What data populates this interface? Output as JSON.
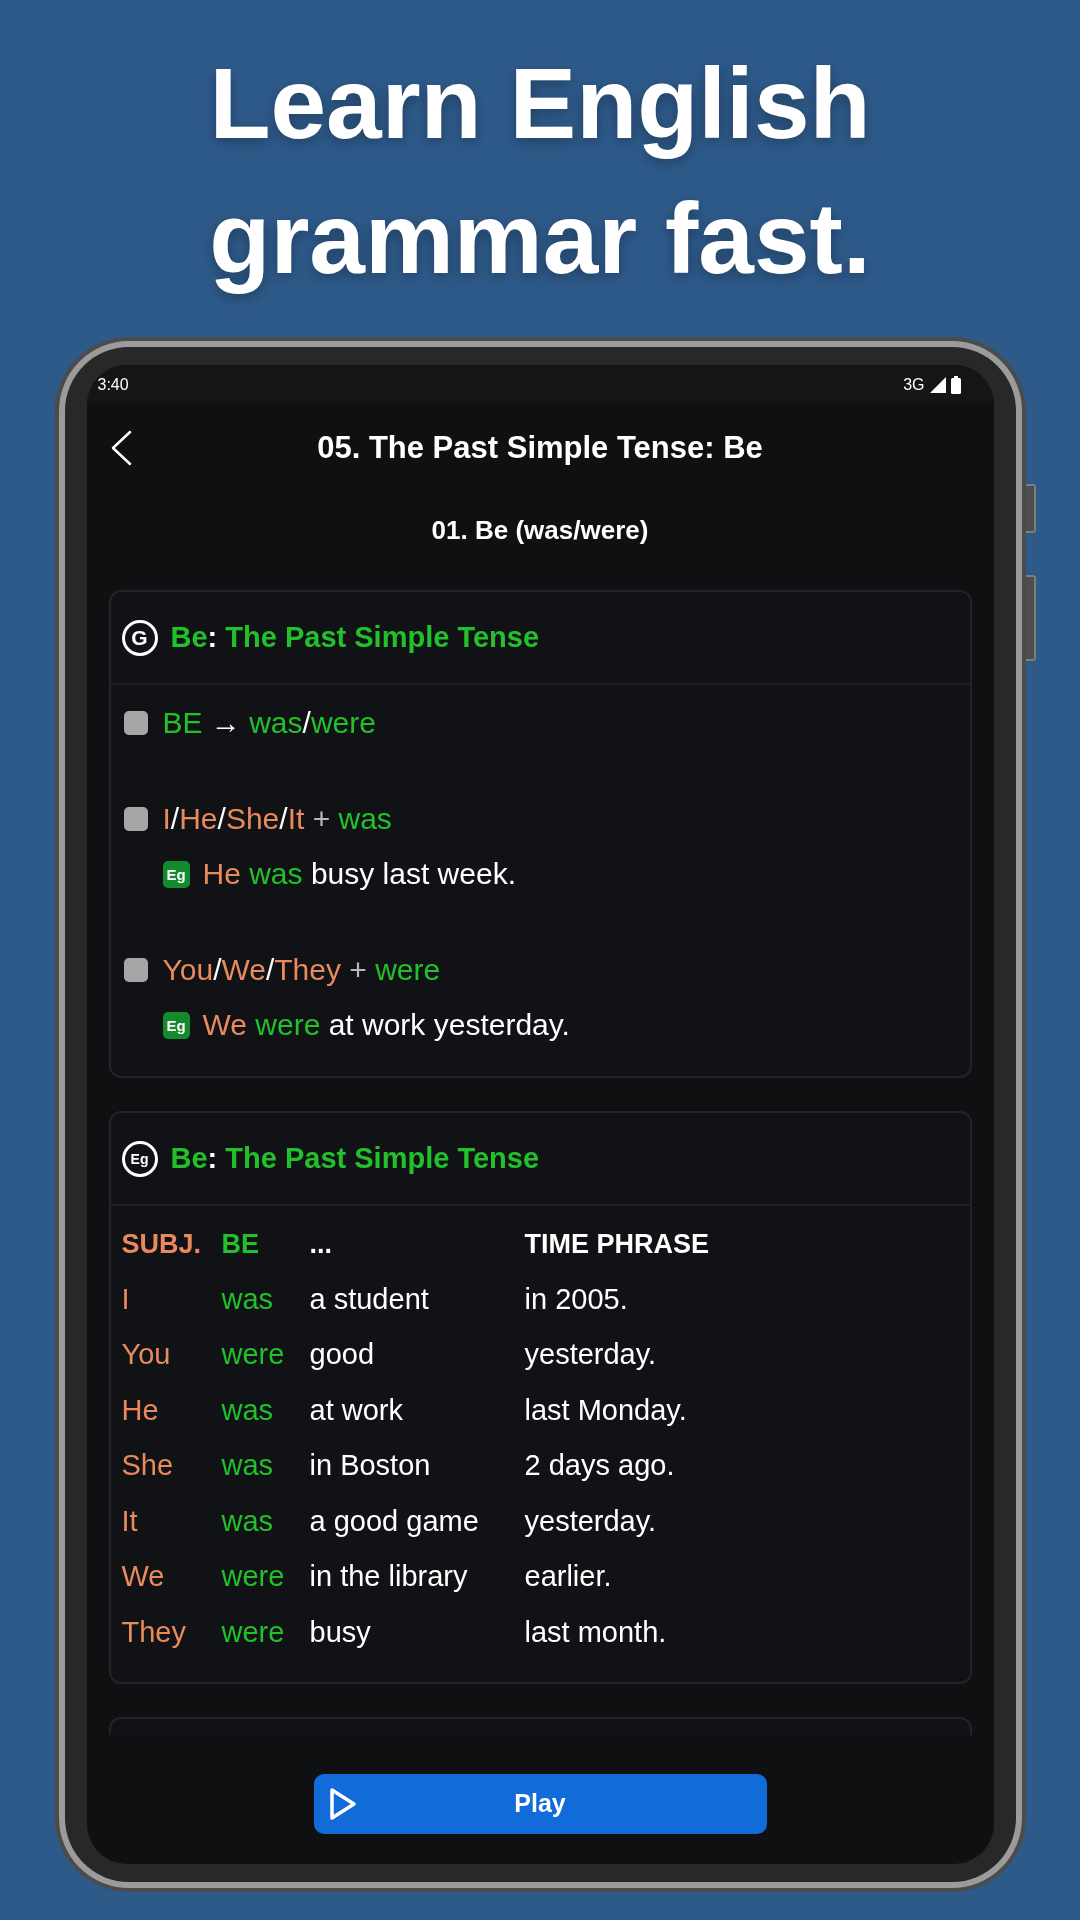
{
  "headline": "Learn English grammar fast.",
  "status_bar": {
    "time": "3:40",
    "network": "3G"
  },
  "header": {
    "title": "05. The Past Simple Tense: Be"
  },
  "lesson": {
    "subtitle": "01. Be (was/were)"
  },
  "cards": [
    {
      "kind": "rules",
      "badge": "G",
      "title": [
        {
          "kind": "accent",
          "text": "Be"
        },
        {
          "kind": "plain",
          "text": ":"
        },
        {
          "kind": "accent",
          "text": " The Past Simple Tense"
        }
      ],
      "rules": [
        {
          "text": [
            {
              "kind": "accent",
              "text": "BE"
            },
            {
              "kind": "plain",
              "text": " → "
            },
            {
              "kind": "accent",
              "text": "was"
            },
            {
              "kind": "plain",
              "text": "/"
            },
            {
              "kind": "accent",
              "text": "were"
            }
          ]
        },
        {
          "text": [
            {
              "kind": "subject",
              "text": "I"
            },
            {
              "kind": "plain",
              "text": "/"
            },
            {
              "kind": "subject",
              "text": "He"
            },
            {
              "kind": "plain",
              "text": "/"
            },
            {
              "kind": "subject",
              "text": "She"
            },
            {
              "kind": "plain",
              "text": "/"
            },
            {
              "kind": "subject",
              "text": "It"
            },
            {
              "kind": "muted",
              "text": " + "
            },
            {
              "kind": "accent",
              "text": "was"
            }
          ],
          "example": {
            "badge": "Eg",
            "text": [
              {
                "kind": "subject",
                "text": "He"
              },
              {
                "kind": "accent",
                "text": " was"
              },
              {
                "kind": "plain",
                "text": " busy last week."
              }
            ]
          }
        },
        {
          "text": [
            {
              "kind": "subject",
              "text": "You"
            },
            {
              "kind": "plain",
              "text": "/"
            },
            {
              "kind": "subject",
              "text": "We"
            },
            {
              "kind": "plain",
              "text": "/"
            },
            {
              "kind": "subject",
              "text": "They"
            },
            {
              "kind": "muted",
              "text": " + "
            },
            {
              "kind": "accent",
              "text": "were"
            }
          ],
          "example": {
            "badge": "Eg",
            "text": [
              {
                "kind": "subject",
                "text": "We"
              },
              {
                "kind": "accent",
                "text": " were"
              },
              {
                "kind": "plain",
                "text": " at work yesterday."
              }
            ]
          }
        }
      ]
    },
    {
      "kind": "table",
      "badge": "Eg",
      "title": [
        {
          "kind": "accent",
          "text": "Be"
        },
        {
          "kind": "plain",
          "text": ":"
        },
        {
          "kind": "accent",
          "text": " The Past Simple Tense"
        }
      ],
      "columns": [
        {
          "label": "SUBJ.",
          "kind": "subject"
        },
        {
          "label": "BE",
          "kind": "accent"
        },
        {
          "label": "...",
          "kind": "plain"
        },
        {
          "label": "TIME PHRASE",
          "kind": "plain"
        }
      ],
      "rows": [
        [
          "I",
          "was",
          "a student",
          "in 2005."
        ],
        [
          "You",
          "were",
          "good",
          "yesterday."
        ],
        [
          "He",
          "was",
          "at work",
          "last Monday."
        ],
        [
          "She",
          "was",
          "in Boston",
          "2 days ago."
        ],
        [
          "It",
          "was",
          "a good game",
          "yesterday."
        ],
        [
          "We",
          "were",
          "in the library",
          "earlier."
        ],
        [
          "They",
          "were",
          "busy",
          "last month."
        ]
      ]
    },
    {
      "kind": "partial"
    }
  ],
  "play_button": {
    "label": "Play"
  }
}
